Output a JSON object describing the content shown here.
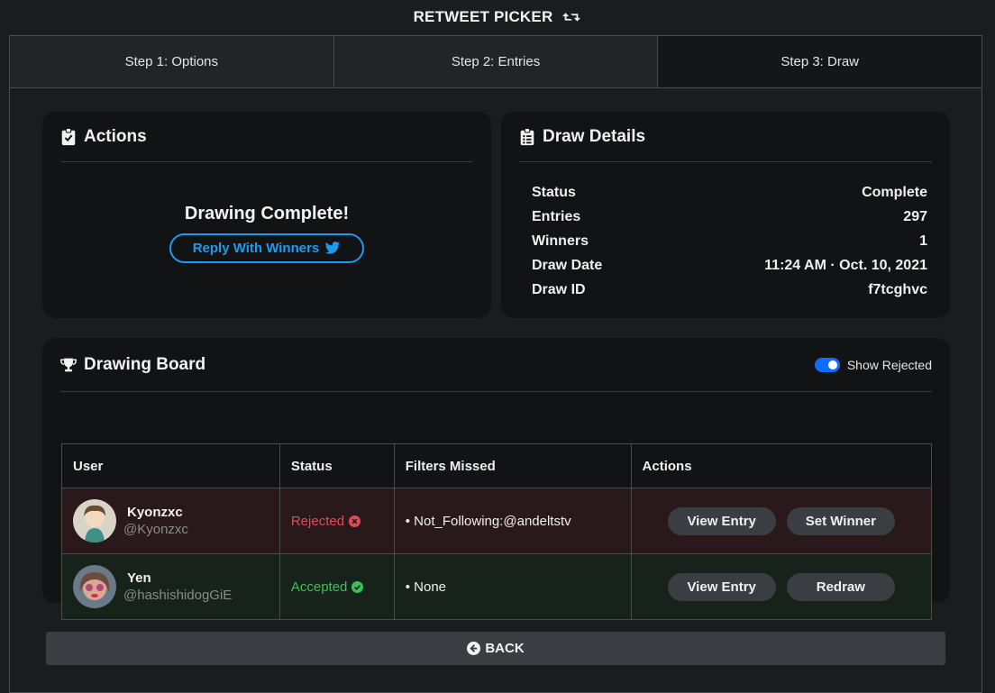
{
  "app": {
    "title": "RETWEET PICKER",
    "title_icon": "retweet-icon"
  },
  "tabs": [
    {
      "label": "Step 1: Options"
    },
    {
      "label": "Step 2: Entries"
    },
    {
      "label": "Step 3: Draw",
      "active": true
    }
  ],
  "actions": {
    "title": "Actions",
    "icon": "clipboard-check-icon",
    "status_text": "Drawing Complete!",
    "reply_button": "Reply With Winners",
    "reply_icon": "twitter-icon"
  },
  "details": {
    "title": "Draw Details",
    "icon": "clipboard-list-icon",
    "rows": [
      {
        "label": "Status",
        "value": "Complete"
      },
      {
        "label": "Entries",
        "value": "297"
      },
      {
        "label": "Winners",
        "value": "1"
      },
      {
        "label": "Draw Date",
        "value": "11:24 AM · Oct. 10, 2021"
      },
      {
        "label": "Draw ID",
        "value": "f7tcghvc"
      }
    ]
  },
  "board": {
    "title": "Drawing Board",
    "icon": "trophy-icon",
    "toggle_label": "Show Rejected",
    "toggle_on": true,
    "columns": [
      "User",
      "Status",
      "Filters Missed",
      "Actions"
    ],
    "rows": [
      {
        "name": "Kyonzxc",
        "handle": "@Kyonzxc",
        "status": "Rejected",
        "status_icon": "x-circle-icon",
        "filter": "• Not_Following:@andeltstv",
        "view_label": "View Entry",
        "action_label": "Set Winner"
      },
      {
        "name": "Yen",
        "handle": "@hashishidogGiE",
        "status": "Accepted",
        "status_icon": "check-circle-icon",
        "filter": "• None",
        "view_label": "View Entry",
        "action_label": "Redraw"
      }
    ]
  },
  "back_button": "BACK",
  "colors": {
    "accent": "#1d9bf0",
    "rejected": "#e04a55",
    "accepted": "#3fbf5c",
    "toggle": "#0d6efd"
  }
}
